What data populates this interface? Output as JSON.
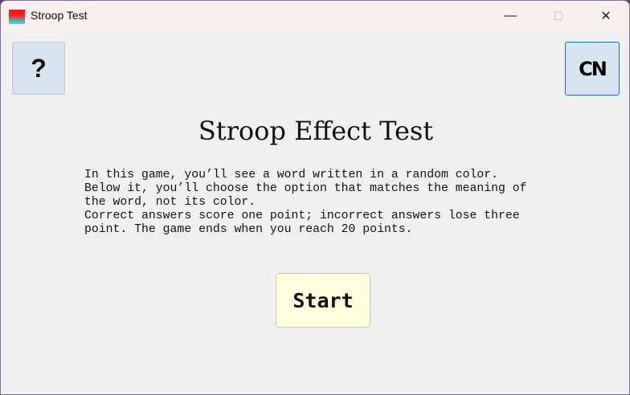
{
  "window": {
    "title": "Stroop Test",
    "minimize": "—",
    "maximize": "☐",
    "close": "✕"
  },
  "toolbar": {
    "help_label": "?",
    "language_label": "CN"
  },
  "main": {
    "heading": "Stroop Effect Test",
    "description_lines": [
      "In this game, you’ll see a word written in a random color.",
      "Below it, you’ll choose the option that matches the meaning of",
      "the word, not its color.",
      "Correct answers score one point; incorrect answers lose three",
      "point. The game ends when you reach 20 points."
    ],
    "start_label": "Start"
  }
}
